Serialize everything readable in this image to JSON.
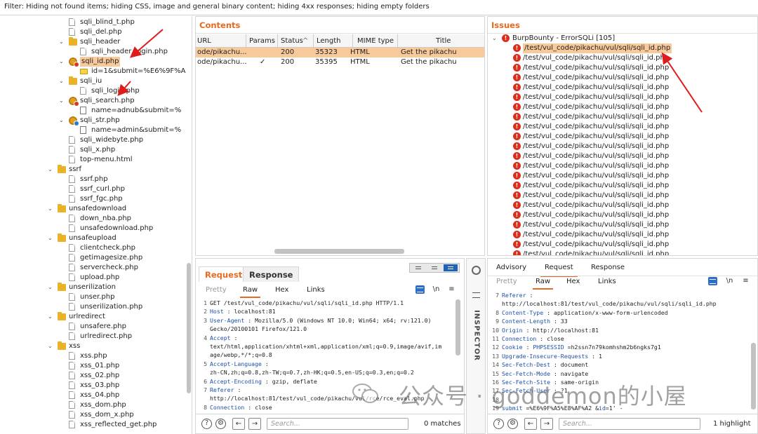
{
  "filter_bar": {
    "text": "Filter: Hiding not found items;  hiding CSS, image and general binary content;  hiding 4xx responses;  hiding empty folders"
  },
  "tree": {
    "items": [
      {
        "label": "sqli_blind_t.php",
        "indent": 2,
        "icon": "file",
        "toggle": ""
      },
      {
        "label": "sqli_del.php",
        "indent": 2,
        "icon": "file",
        "toggle": ""
      },
      {
        "label": "sqli_header",
        "indent": 2,
        "icon": "folder",
        "toggle": "open"
      },
      {
        "label": "sqli_header_login.php",
        "indent": 3,
        "icon": "file",
        "toggle": ""
      },
      {
        "label": "sqli_id.php",
        "indent": 2,
        "icon": "gear-red",
        "toggle": "open",
        "highlighted": true
      },
      {
        "label": "id=1&submit=%E6%9F%A",
        "indent": 3,
        "icon": "envelope",
        "toggle": ""
      },
      {
        "label": "sqli_iu",
        "indent": 2,
        "icon": "folder",
        "toggle": "open"
      },
      {
        "label": "sqli_login.php",
        "indent": 3,
        "icon": "file",
        "toggle": ""
      },
      {
        "label": "sqli_search.php",
        "indent": 2,
        "icon": "gear-red",
        "toggle": "open"
      },
      {
        "label": "name=adnub&submit=%",
        "indent": 3,
        "icon": "param",
        "toggle": ""
      },
      {
        "label": "sqli_str.php",
        "indent": 2,
        "icon": "gear-blue",
        "toggle": "open"
      },
      {
        "label": "name=admin&submit=%",
        "indent": 3,
        "icon": "param",
        "toggle": ""
      },
      {
        "label": "sqli_widebyte.php",
        "indent": 2,
        "icon": "file",
        "toggle": ""
      },
      {
        "label": "sqli_x.php",
        "indent": 2,
        "icon": "file",
        "toggle": ""
      },
      {
        "label": "top-menu.html",
        "indent": 2,
        "icon": "file",
        "toggle": ""
      },
      {
        "label": "ssrf",
        "indent": 1,
        "icon": "folder",
        "toggle": "open"
      },
      {
        "label": "ssrf.php",
        "indent": 2,
        "icon": "file",
        "toggle": ""
      },
      {
        "label": "ssrf_curl.php",
        "indent": 2,
        "icon": "file",
        "toggle": ""
      },
      {
        "label": "ssrf_fgc.php",
        "indent": 2,
        "icon": "file",
        "toggle": ""
      },
      {
        "label": "unsafedownload",
        "indent": 1,
        "icon": "folder",
        "toggle": "open"
      },
      {
        "label": "down_nba.php",
        "indent": 2,
        "icon": "file",
        "toggle": ""
      },
      {
        "label": "unsafedownload.php",
        "indent": 2,
        "icon": "file",
        "toggle": ""
      },
      {
        "label": "unsafeupload",
        "indent": 1,
        "icon": "folder",
        "toggle": "open"
      },
      {
        "label": "clientcheck.php",
        "indent": 2,
        "icon": "file",
        "toggle": ""
      },
      {
        "label": "getimagesize.php",
        "indent": 2,
        "icon": "file",
        "toggle": ""
      },
      {
        "label": "servercheck.php",
        "indent": 2,
        "icon": "file",
        "toggle": ""
      },
      {
        "label": "upload.php",
        "indent": 2,
        "icon": "file",
        "toggle": ""
      },
      {
        "label": "unserilization",
        "indent": 1,
        "icon": "folder",
        "toggle": "open"
      },
      {
        "label": "unser.php",
        "indent": 2,
        "icon": "file",
        "toggle": ""
      },
      {
        "label": "unserilization.php",
        "indent": 2,
        "icon": "file",
        "toggle": ""
      },
      {
        "label": "urlredirect",
        "indent": 1,
        "icon": "folder",
        "toggle": "open"
      },
      {
        "label": "unsafere.php",
        "indent": 2,
        "icon": "file",
        "toggle": ""
      },
      {
        "label": "urlredirect.php",
        "indent": 2,
        "icon": "file",
        "toggle": ""
      },
      {
        "label": "xss",
        "indent": 1,
        "icon": "folder",
        "toggle": "open"
      },
      {
        "label": "xss.php",
        "indent": 2,
        "icon": "file",
        "toggle": ""
      },
      {
        "label": "xss_01.php",
        "indent": 2,
        "icon": "file",
        "toggle": ""
      },
      {
        "label": "xss_02.php",
        "indent": 2,
        "icon": "file",
        "toggle": ""
      },
      {
        "label": "xss_03.php",
        "indent": 2,
        "icon": "file",
        "toggle": ""
      },
      {
        "label": "xss_04.php",
        "indent": 2,
        "icon": "file",
        "toggle": ""
      },
      {
        "label": "xss_dom.php",
        "indent": 2,
        "icon": "file",
        "toggle": ""
      },
      {
        "label": "xss_dom_x.php",
        "indent": 2,
        "icon": "file",
        "toggle": ""
      },
      {
        "label": "xss_reflected_get.php",
        "indent": 2,
        "icon": "file",
        "toggle": ""
      }
    ]
  },
  "contents": {
    "title": "Contents",
    "columns": [
      "URL",
      "Params",
      "Status",
      "Length",
      "MIME type",
      "Title"
    ],
    "sort_indicator": "^",
    "rows": [
      {
        "url": "ode/pikachu...",
        "params": "",
        "status": "200",
        "length": "35323",
        "mime": "HTML",
        "title": "Get the pikachu",
        "selected": true
      },
      {
        "url": "ode/pikachu...",
        "params": "✓",
        "status": "200",
        "length": "35395",
        "mime": "HTML",
        "title": "Get the pikachu",
        "selected": false
      }
    ]
  },
  "issues": {
    "title": "Issues",
    "group": "BurpBounty - ErrorSQLi [105]",
    "items": [
      "/test/vul_code/pikachu/vul/sqli/sqli_id.php",
      "/test/vul_code/pikachu/vul/sqli/sqli_id.php",
      "/test/vul_code/pikachu/vul/sqli/sqli_id.php",
      "/test/vul_code/pikachu/vul/sqli/sqli_id.php",
      "/test/vul_code/pikachu/vul/sqli/sqli_id.php",
      "/test/vul_code/pikachu/vul/sqli/sqli_id.php",
      "/test/vul_code/pikachu/vul/sqli/sqli_id.php",
      "/test/vul_code/pikachu/vul/sqli/sqli_id.php",
      "/test/vul_code/pikachu/vul/sqli/sqli_id.php",
      "/test/vul_code/pikachu/vul/sqli/sqli_id.php",
      "/test/vul_code/pikachu/vul/sqli/sqli_id.php",
      "/test/vul_code/pikachu/vul/sqli/sqli_id.php",
      "/test/vul_code/pikachu/vul/sqli/sqli_id.php",
      "/test/vul_code/pikachu/vul/sqli/sqli_id.php",
      "/test/vul_code/pikachu/vul/sqli/sqli_id.php",
      "/test/vul_code/pikachu/vul/sqli/sqli_id.php",
      "/test/vul_code/pikachu/vul/sqli/sqli_id.php",
      "/test/vul_code/pikachu/vul/sqli/sqli_id.php",
      "/test/vul_code/pikachu/vul/sqli/sqli_id.php",
      "/test/vul_code/pikachu/vul/sqli/sqli_id.php",
      "/test/vul_code/pikachu/vul/sqli/sqli_id.php",
      "/test/vul_code/pikachu/vul/sqli/sqli_id.php"
    ]
  },
  "request_pane": {
    "tab_request": "Request",
    "tab_response": "Response",
    "subtabs": {
      "pretty": "Pretty",
      "raw": "Raw",
      "hex": "Hex",
      "links": "Links",
      "newline": "\\n"
    },
    "lines": [
      {
        "n": "1",
        "parts": [
          [
            "cv",
            "GET /test/vul_code/pikachu/vul/sqli/sqli_id.php   HTTP/1.1"
          ]
        ]
      },
      {
        "n": "2",
        "parts": [
          [
            "hk",
            "Host"
          ],
          [
            "cv",
            " : localhost:81"
          ]
        ]
      },
      {
        "n": "3",
        "parts": [
          [
            "hk",
            "User-Agent"
          ],
          [
            "cv",
            " : Mozilla/5.0  (Windows  NT 10.0;  Win64;  x64;  rv:121.0)"
          ]
        ]
      },
      {
        "n": "",
        "parts": [
          [
            "cv",
            "Gecko/20100101  Firefox/121.0"
          ]
        ]
      },
      {
        "n": "4",
        "parts": [
          [
            "hk",
            "Accept"
          ],
          [
            "cv",
            " :"
          ]
        ]
      },
      {
        "n": "",
        "parts": [
          [
            "cv",
            "text/html,application/xhtml+xml,application/xml;q=0.9,image/avif,im"
          ]
        ]
      },
      {
        "n": "",
        "parts": [
          [
            "cv",
            "age/webp,*/*;q=0.8"
          ]
        ]
      },
      {
        "n": "5",
        "parts": [
          [
            "hk",
            "Accept-Language"
          ],
          [
            "cv",
            " :"
          ]
        ]
      },
      {
        "n": "",
        "parts": [
          [
            "cv",
            "zh-CN,zh;q=0.8,zh-TW;q=0.7,zh-HK;q=0.5,en-US;q=0.3,en;q=0.2"
          ]
        ]
      },
      {
        "n": "6",
        "parts": [
          [
            "hk",
            "Accept-Encoding"
          ],
          [
            "cv",
            " : gzip,  deflate"
          ]
        ]
      },
      {
        "n": "7",
        "parts": [
          [
            "hk",
            "Referer"
          ],
          [
            "cv",
            " :"
          ]
        ]
      },
      {
        "n": "",
        "parts": [
          [
            "cv",
            "http://localhost:81/test/vul_code/pikachu/vul/rce/rce_eval.php"
          ]
        ]
      },
      {
        "n": "8",
        "parts": [
          [
            "hk",
            "Connection"
          ],
          [
            "cv",
            " : close"
          ]
        ]
      }
    ],
    "search_placeholder": "Search...",
    "matches": "0 matches"
  },
  "inspector": {
    "label": "INSPECTOR"
  },
  "right_pane": {
    "tabs": {
      "advisory": "Advisory",
      "request": "Request",
      "response": "Response"
    },
    "subtabs": {
      "pretty": "Pretty",
      "raw": "Raw",
      "hex": "Hex",
      "links": "Links",
      "newline": "\\n"
    },
    "lines": [
      {
        "n": "7",
        "parts": [
          [
            "hk",
            "Referer"
          ],
          [
            "cv",
            " :"
          ]
        ]
      },
      {
        "n": "",
        "parts": [
          [
            "cv",
            "http://localhost:81/test/vul_code/pikachu/vul/sqli/sqli_id.php"
          ]
        ]
      },
      {
        "n": "8",
        "parts": [
          [
            "hk",
            "Content-Type"
          ],
          [
            "cv",
            " : application/x-www-form-urlencoded"
          ]
        ]
      },
      {
        "n": "9",
        "parts": [
          [
            "hk",
            "Content-Length"
          ],
          [
            "cv",
            " : 33"
          ]
        ]
      },
      {
        "n": "10",
        "parts": [
          [
            "hk",
            "Origin"
          ],
          [
            "cv",
            " : http://localhost:81"
          ]
        ]
      },
      {
        "n": "11",
        "parts": [
          [
            "hk",
            "Connection"
          ],
          [
            "cv",
            " : close"
          ]
        ]
      },
      {
        "n": "12",
        "parts": [
          [
            "hk",
            "Cookie"
          ],
          [
            "cv",
            " : "
          ],
          [
            "hk",
            "PHPSESSID"
          ],
          [
            "cv",
            " =h2ssn7n79komhshm2b6ngks7g1"
          ]
        ]
      },
      {
        "n": "13",
        "parts": [
          [
            "hk",
            "Upgrade-Insecure-Requests"
          ],
          [
            "cv",
            "  : 1"
          ]
        ]
      },
      {
        "n": "14",
        "parts": [
          [
            "hk",
            "Sec-Fetch-Dest"
          ],
          [
            "cv",
            " : document"
          ]
        ]
      },
      {
        "n": "15",
        "parts": [
          [
            "hk",
            "Sec-Fetch-Mode"
          ],
          [
            "cv",
            " : navigate"
          ]
        ]
      },
      {
        "n": "16",
        "parts": [
          [
            "hk",
            "Sec-Fetch-Site"
          ],
          [
            "cv",
            " : same-origin"
          ]
        ]
      },
      {
        "n": "17",
        "parts": [
          [
            "hk",
            "Sec-Fetch-User"
          ],
          [
            "cv",
            " : ?1"
          ]
        ]
      },
      {
        "n": "18",
        "parts": [
          [
            "cv",
            ""
          ]
        ]
      },
      {
        "n": "19",
        "parts": [
          [
            "hk",
            "submit"
          ],
          [
            "cv",
            " =%E6%9F%A5%E8%AF%A2 &"
          ],
          [
            "hk",
            "id"
          ],
          [
            "cv",
            "=1' -"
          ]
        ]
      }
    ],
    "search_placeholder": "Search...",
    "matches": "1 highlight"
  },
  "watermark": {
    "text": "公众号 · goddemon的小屋"
  },
  "colors": {
    "accent": "#e8691f",
    "selection": "#f8c99a",
    "issue_red": "#dc2d1c",
    "link_blue": "#1e63b5"
  }
}
